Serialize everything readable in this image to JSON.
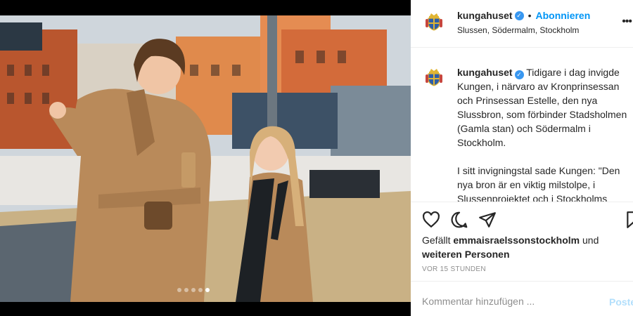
{
  "post": {
    "username": "kungahuset",
    "follow_label": "Abonnieren",
    "location": "Slussen, Södermalm, Stockholm",
    "caption_para1": "Tidigare i dag invigde Kungen, i närvaro av Kronprinsessan och Prinsessan Estelle, den nya Slussbron, som förbinder Stadsholmen (Gamla stan) och Södermalm i Stockholm.",
    "caption_para2": "I sitt invigningstal sade Kungen: \"Den nya bron är en viktig milstolpe, i Slussenprojektet och i Stockholms",
    "likes_prefix": "Gefällt",
    "likes_user": "emmaisraelssonstockholm",
    "likes_and": "und",
    "likes_others": "weiteren Personen",
    "timestamp": "VOR 15 STUNDEN",
    "comment_placeholder": "Kommentar hinzufügen ...",
    "post_label": "Posten"
  },
  "carousel": {
    "count": 5,
    "active_index": 4
  },
  "icons": {
    "more": "more-icon",
    "heart": "heart-icon",
    "comment": "comment-icon",
    "share": "share-icon",
    "bookmark": "bookmark-icon",
    "verified": "verified-badge-icon",
    "avatar": "royal-crest-icon"
  },
  "colors": {
    "accent": "#0095f6",
    "verified": "#3897f0",
    "muted": "#8e8e8e",
    "text": "#262626"
  }
}
